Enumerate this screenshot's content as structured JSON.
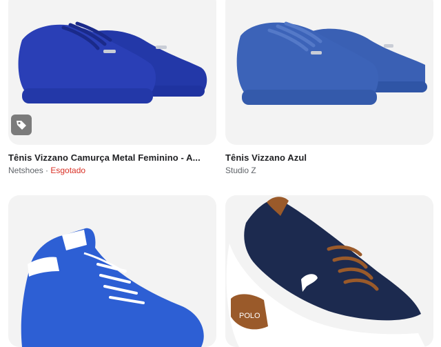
{
  "products": [
    {
      "title": "Tênis Vizzano Camurça Metal Feminino - A...",
      "store": "Netshoes",
      "separator": " · ",
      "status": "Esgotado",
      "icon": "tag-icon",
      "colors": {
        "shoe": "#2a3fb6",
        "sole": "#2338a8"
      }
    },
    {
      "title": "Tênis Vizzano Azul",
      "store": "Studio Z",
      "colors": {
        "shoe": "#3c63b8",
        "sole": "#345aab"
      }
    },
    {
      "colors": {
        "shoe": "#2d5fd4",
        "trim": "#ffffff"
      }
    },
    {
      "logo_text": "POLO",
      "colors": {
        "shoe": "#1c2a4f",
        "sole": "#ffffff",
        "lace": "#9a5a2a"
      }
    }
  ],
  "colors": {
    "card_bg": "#f3f3f3",
    "status_red": "#d93025",
    "muted": "#5f6368"
  }
}
